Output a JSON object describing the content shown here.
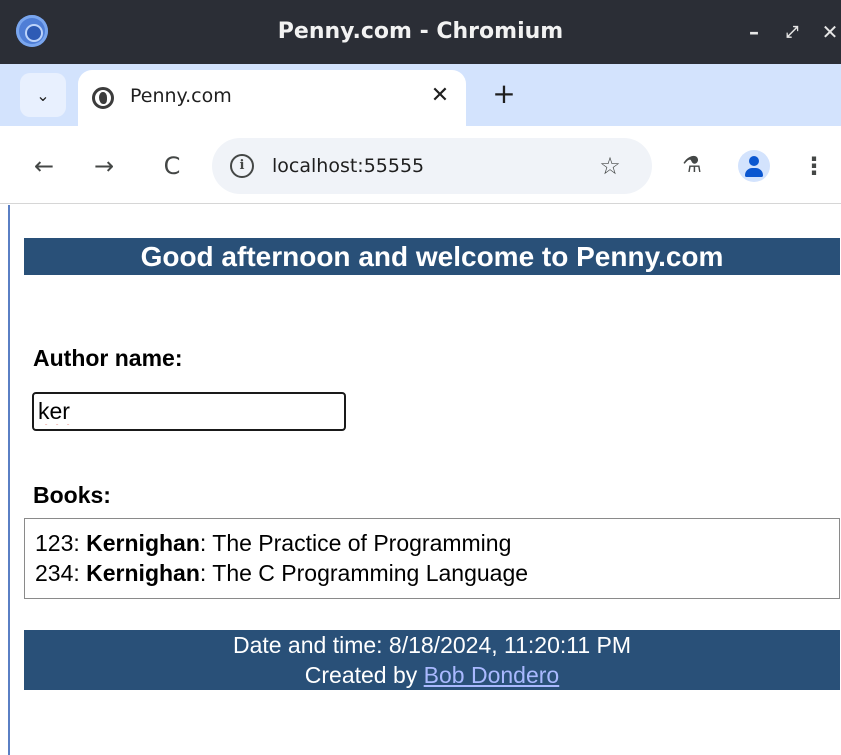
{
  "window": {
    "title": "Penny.com - Chromium",
    "controls": {
      "minimize": "–",
      "maximize": "⤢",
      "close": "✕"
    }
  },
  "tabs": [
    {
      "title": "Penny.com",
      "close": "✕",
      "icon": "globe-icon"
    }
  ],
  "tabstrip": {
    "menu": "⌄",
    "new_tab": "+"
  },
  "toolbar": {
    "back": "←",
    "forward": "→",
    "reload": "C",
    "url": "localhost:55555",
    "info": "i",
    "bookmark": "☆",
    "labs": "⚗",
    "menu": "⋮"
  },
  "page": {
    "banner": "Good afternoon and welcome to Penny.com",
    "author_label": "Author name:",
    "author_value": "ker",
    "books_label": "Books:",
    "books": [
      {
        "isbn": "123",
        "author": "Kernighan",
        "title": "The Practice of Programming"
      },
      {
        "isbn": "234",
        "author": "Kernighan",
        "title": "The C Programming Language"
      }
    ],
    "footer": {
      "datetime": "Date and time: 8/18/2024, 11:20:11 PM",
      "created_by_prefix": "Created by",
      "author_link": "Bob Dondero"
    }
  },
  "colors": {
    "banner_bg": "#295078",
    "titlebar_bg": "#2b2e36",
    "tabstrip_bg": "#d3e3fd",
    "link": "#a9b9ff"
  }
}
